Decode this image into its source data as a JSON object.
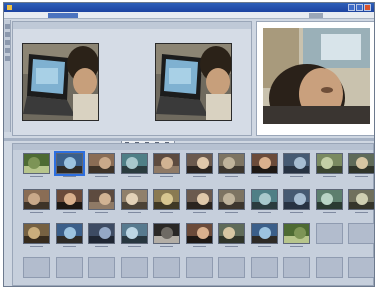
{
  "window": {
    "title": "",
    "menu": []
  },
  "colors": {
    "titlebar": "#1d43a0",
    "selection": "#2d6fe0",
    "scrub_green": "#4fa05b",
    "scrub_red": "#d23d3d",
    "panel": "#d5dce6"
  },
  "editor": {
    "source_monitor": {
      "scene": "laptop-screen"
    },
    "program_monitor": {
      "scene": "laptop-screen"
    },
    "transport_buttons": [
      "rewind-icon",
      "play-icon",
      "pause-icon",
      "stop-icon",
      "forward-icon"
    ],
    "source_scrub_progress": 0.62,
    "program_scrub_progress": 0.0
  },
  "viewer": {
    "scene": "person-closeup"
  },
  "bin": {
    "rows": [
      [
        "a",
        "b",
        "c",
        "d",
        "e",
        "f",
        "g",
        "h",
        "i",
        "j",
        "k"
      ],
      [
        "c",
        "h",
        "e",
        "l",
        "m",
        "f",
        "g",
        "d",
        "i",
        "n",
        "o"
      ],
      [
        "p",
        "b",
        "q",
        "r",
        "s",
        "h",
        "k",
        "b",
        "a",
        "empty",
        "empty"
      ],
      [
        "empty",
        "empty",
        "empty",
        "empty",
        "empty",
        "empty",
        "empty",
        "empty",
        "empty",
        "empty",
        "empty"
      ]
    ],
    "selected": [
      0,
      1
    ]
  }
}
